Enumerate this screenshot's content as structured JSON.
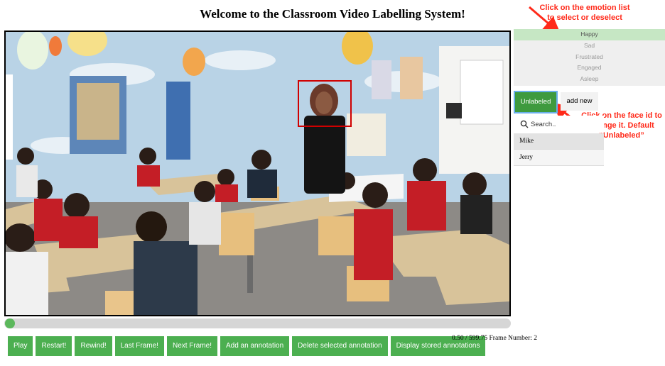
{
  "title": "Welcome to the Classroom Video Labelling System!",
  "annotations": {
    "emotion_note": [
      "Click on the emotion list",
      "to select or deselect"
    ],
    "face_note": [
      "Click on the face id to",
      "change it. Default",
      "“Unlabeled”"
    ]
  },
  "emotions": {
    "items": [
      "Happy",
      "Sad",
      "Frustrated",
      "Engaged",
      "Asleep"
    ],
    "selected": "Happy"
  },
  "face_id": {
    "current_label": "Unlabeled",
    "add_new_label": "add new",
    "search_placeholder": "Search..",
    "names": [
      "Mike",
      "Jerry"
    ]
  },
  "controls": {
    "buttons": [
      "Play",
      "Restart!",
      "Rewind!",
      "Last Frame!",
      "Next Frame!",
      "Add an annotation",
      "Delete selected annotation",
      "Display stored annotations"
    ],
    "time_readout": "0.50 / 599.75 Frame Number: 2",
    "playback_position": 0.0008
  },
  "colors": {
    "button_green": "#4caf50",
    "selected_emotion": "#c6e7c4",
    "annotation_red": "#ff2a1a",
    "face_box_red": "#d00000"
  }
}
